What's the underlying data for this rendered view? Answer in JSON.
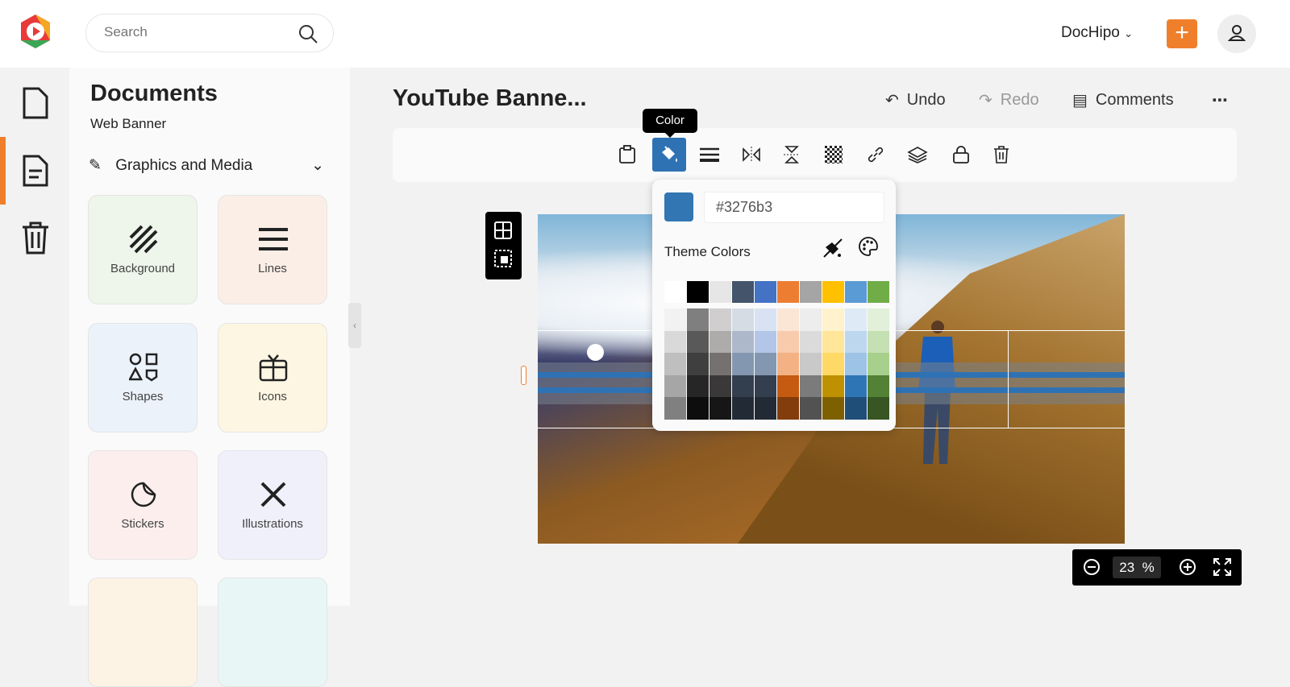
{
  "header": {
    "search_placeholder": "Search",
    "account": "DocHipo",
    "add_label": "+"
  },
  "panel": {
    "title": "Documents",
    "subtitle": "Web Banner",
    "category": "Graphics and Media",
    "cards": [
      {
        "label": "Background"
      },
      {
        "label": "Lines"
      },
      {
        "label": "Shapes"
      },
      {
        "label": "Icons"
      },
      {
        "label": "Stickers"
      },
      {
        "label": "Illustrations"
      }
    ]
  },
  "editor": {
    "doc_title": "YouTube Banne...",
    "undo": "Undo",
    "redo": "Redo",
    "comments": "Comments",
    "tooltip": "Color"
  },
  "picker": {
    "hex": "#3276b3",
    "theme_label": "Theme Colors",
    "theme_row": [
      "#ffffff",
      "#000000",
      "#e7e6e6",
      "#44546a",
      "#4472c4",
      "#ed7d31",
      "#a5a5a5",
      "#ffc000",
      "#5b9bd5",
      "#70ad47"
    ],
    "shades": [
      [
        "#f2f2f2",
        "#d9d9d9",
        "#bfbfbf",
        "#a6a6a6",
        "#808080"
      ],
      [
        "#7f7f7f",
        "#595959",
        "#3f3f3f",
        "#262626",
        "#0d0d0d"
      ],
      [
        "#d0cece",
        "#aeabab",
        "#757171",
        "#3a3838",
        "#171616"
      ],
      [
        "#d6dce4",
        "#adb9ca",
        "#8497b0",
        "#333f4f",
        "#222a35"
      ],
      [
        "#d9e2f3",
        "#b4c6e7",
        "#8497b0",
        "#333f4f",
        "#222a35"
      ],
      [
        "#fbe5d5",
        "#f8cbad",
        "#f4b183",
        "#c55a11",
        "#833c0b"
      ],
      [
        "#ededed",
        "#dbdbdb",
        "#c9c9c9",
        "#7b7b7b",
        "#525252"
      ],
      [
        "#fff2cc",
        "#ffe699",
        "#ffd966",
        "#bf9000",
        "#7f6000"
      ],
      [
        "#deebf6",
        "#bdd7ee",
        "#9dc3e6",
        "#2e75b5",
        "#1f4e79"
      ],
      [
        "#e2efd9",
        "#c5e0b3",
        "#a8d08d",
        "#538135",
        "#375623"
      ]
    ]
  },
  "zoom": {
    "value": "23",
    "unit": "%"
  },
  "colors": {
    "accent": "#f07f2c",
    "selected": "#3276b3"
  }
}
